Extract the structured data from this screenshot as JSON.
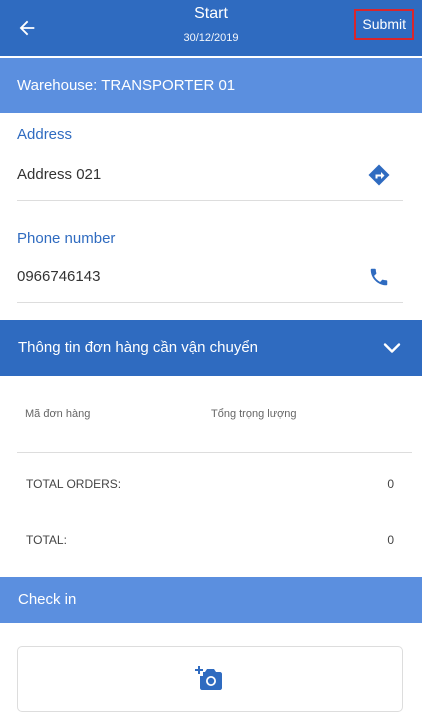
{
  "header": {
    "title": "Start",
    "date": "30/12/2019",
    "submit_label": "Submit",
    "back_icon": "arrow-left-icon"
  },
  "warehouse": {
    "label": "Warehouse: TRANSPORTER 01"
  },
  "address": {
    "label": "Address",
    "value": "Address 021",
    "icon": "directions-icon"
  },
  "phone": {
    "label": "Phone number",
    "value": "0966746143",
    "icon": "phone-icon"
  },
  "orders_section": {
    "title": "Thông tin đơn hàng cần vận chuyển",
    "icon": "chevron-down-icon",
    "columns": [
      "Mã đơn hàng",
      "Tổng trọng lượng"
    ],
    "total_orders_label": "TOTAL ORDERS:",
    "total_orders_value": "0",
    "total_label": "TOTAL:",
    "total_value": "0"
  },
  "checkin": {
    "title": "Check in",
    "icon": "add-photo-icon"
  },
  "colors": {
    "primary": "#2f6bc0",
    "primary_light": "#5b8fdf",
    "highlight": "#d9262c"
  }
}
